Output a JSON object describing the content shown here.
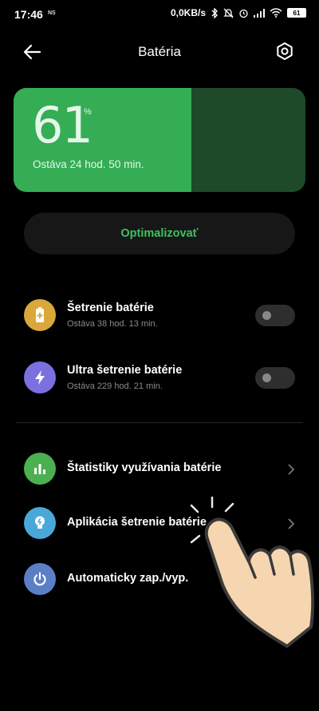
{
  "status_bar": {
    "time": "17:46",
    "carrier_tag": "NS",
    "speed": "0,0KB/s",
    "battery_level": "61"
  },
  "header": {
    "title": "Batéria",
    "back_icon": "arrow-left-icon",
    "settings_icon": "gear-hexagon-icon"
  },
  "battery": {
    "percent": "61",
    "percent_sign": "%",
    "remaining": "Ostáva 24 hod. 50 min.",
    "level_fraction": 0.61,
    "fill_color": "#34ad55",
    "empty_color": "#1e4a2a"
  },
  "optimize": {
    "label": "Optimalizovať"
  },
  "modes": [
    {
      "title": "Šetrenie batérie",
      "subtitle": "Ostáva 38 hod. 13 min.",
      "icon": "battery-saver-icon",
      "color": "#d9a73a",
      "enabled": false
    },
    {
      "title": "Ultra šetrenie batérie",
      "subtitle": "Ostáva 229 hod. 21 min.",
      "icon": "lightning-icon",
      "color": "#7c6fe0",
      "enabled": false
    }
  ],
  "links": [
    {
      "title": "Štatistiky využívania batérie",
      "icon": "bar-chart-icon",
      "color": "#4caf50"
    },
    {
      "title": "Aplikácia šetrenie batérie",
      "icon": "lightbulb-icon",
      "color": "#4aa8d8"
    },
    {
      "title": "Automaticky zap./vyp.",
      "icon": "power-icon",
      "color": "#5b7fc4"
    }
  ]
}
